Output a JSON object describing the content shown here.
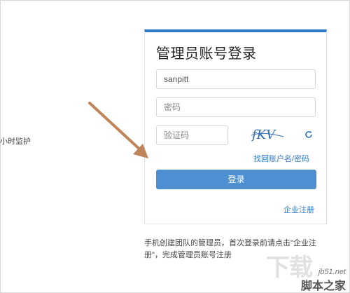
{
  "left_partial_text": "小时监护",
  "login_card": {
    "title": "管理员账号登录",
    "username_value": "sanpitt",
    "password_placeholder": "密码",
    "captcha_placeholder": "验证码",
    "captcha_text": "fKV",
    "forgot_link": "找回账户名/密码",
    "login_button": "登录",
    "enterprise_register_link": "企业注册"
  },
  "note_text": "手机创建团队的管理员，首次登录前请点击\"企业注册\"，完成管理员账号注册",
  "watermark": {
    "big": "下载",
    "site": "jb51.net",
    "name": "脚本之家"
  },
  "colors": {
    "accent": "#2f79c8",
    "button": "#4d8fd1",
    "arrow": "#c0845a"
  },
  "icons": {
    "refresh": "refresh-icon",
    "arrow": "annotation-arrow"
  }
}
